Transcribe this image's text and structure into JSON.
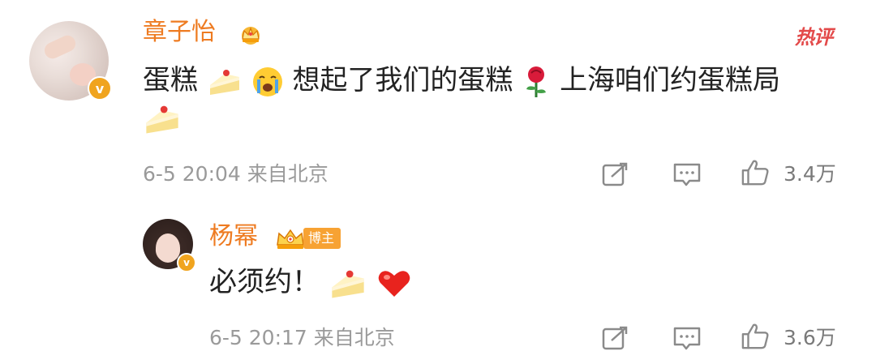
{
  "main_comment": {
    "username": "章子怡",
    "verified_mark": "v",
    "hot_label": "热评",
    "text_parts": [
      "蛋糕",
      "想起了我们的蛋糕",
      "上海咱们约蛋糕局"
    ],
    "emojis": [
      "cake-emoji",
      "crying-face-emoji",
      "rose-emoji",
      "cake-emoji"
    ],
    "timestamp": "6-5 20:04 来自北京",
    "like_count": "3.4万"
  },
  "reply": {
    "username": "杨幂",
    "verified_mark": "v",
    "badge_label": "博主",
    "text": "必须约！",
    "emojis": [
      "cake-emoji",
      "red-heart-emoji"
    ],
    "timestamp": "6-5 20:17 来自北京",
    "like_count": "3.6万"
  },
  "colors": {
    "username": "#ee7b21",
    "meta": "#9a9a9a",
    "hot_label": "#e34a4a",
    "badge_bg": "#f7a233",
    "verified": "#f0a41f"
  },
  "icons": [
    "share-icon",
    "comment-icon",
    "like-icon",
    "crown-icon"
  ]
}
